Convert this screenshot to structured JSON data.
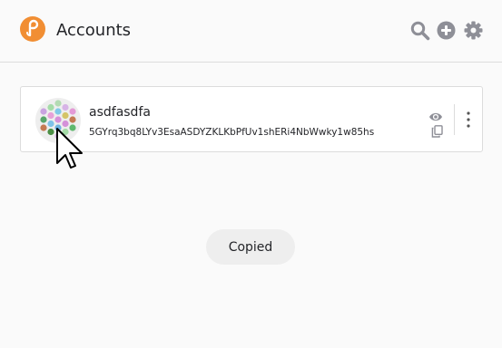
{
  "header": {
    "title": "Accounts",
    "logo_icon": "polkadot-logo-icon",
    "search_icon": "search-icon",
    "add_icon": "plus-circle-icon",
    "settings_icon": "gear-icon"
  },
  "account": {
    "name": "asdfasdfa",
    "address": "5GYrq3bq8LYv3EsaASDYZKLKbPfUv1shERi4NbWwky1w85hs",
    "avatar_icon": "identicon-icon",
    "show_icon": "eye-icon",
    "copy_icon": "copy-icon",
    "menu_icon": "vertical-dots-icon"
  },
  "toast": {
    "text": "Copied"
  },
  "colors": {
    "brand": "#f18e33",
    "icon_gray": "#8e8f97",
    "background": "#fafafa",
    "card": "#ffffff",
    "toast_bg": "#eeeeee"
  }
}
